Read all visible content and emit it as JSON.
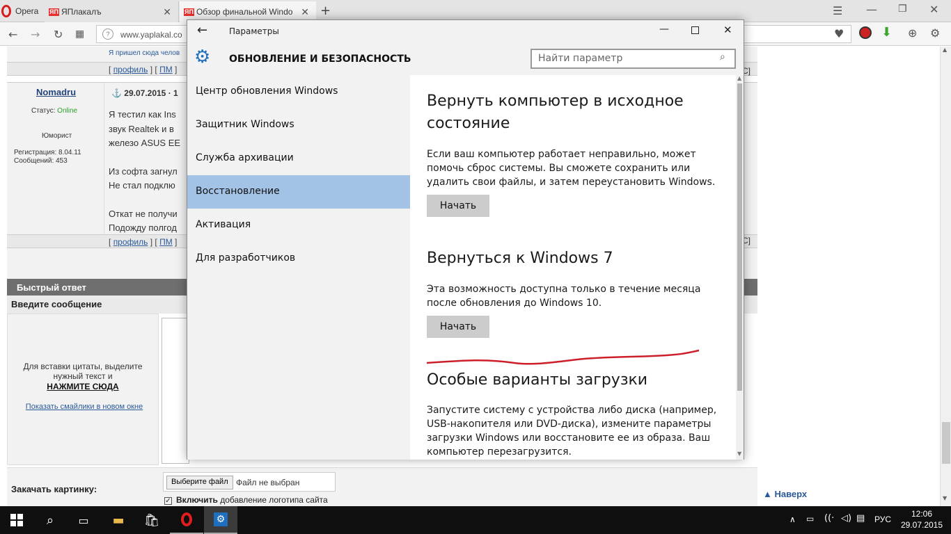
{
  "browser": {
    "brand": "Opera",
    "tabs": [
      {
        "label": "ЯПлакалъ",
        "fav": "ЯП"
      },
      {
        "label": "Обзор финальной Windo",
        "fav": "ЯП"
      }
    ],
    "address": "www.yaplakal.co",
    "new_tab": "+"
  },
  "forum": {
    "prev_post_text": "Я пришел сюда челов",
    "post_links": [
      "[",
      "профиль",
      "] [",
      "ПМ",
      "]"
    ],
    "author": "Nomadru",
    "post_date": "29.07.2015 · 1",
    "status_label": "Статус:",
    "status_value": "Online",
    "rank": "Юморист",
    "reg": "Регистрация: 8.04.11",
    "msgs": "Сообщений: 453",
    "post_lines": [
      "Я тестил как Ins",
      "звук Realtek и в",
      "железо ASUS EE",
      "",
      "Из софта загнул",
      "Не стал подклю",
      "",
      "Откат не получи",
      "Подожду полгод"
    ],
    "quick_reply": "Быстрый ответ",
    "enter_message": "Введите сообщение",
    "quote_hint": "Для вставки цитаты, выделите нужный текст и",
    "click_here": "НАЖМИТЕ СЮДА",
    "smiles_link": "Показать смайлики в новом окне",
    "upload_label": "Закачать картинку:",
    "choose_file": "Выберите файл",
    "no_file": "Файл не выбран",
    "logo_bold": "Включить",
    "logo_rest": "добавление логотипа сайта",
    "top_link": "Наверх"
  },
  "settings": {
    "title": "Параметры",
    "section": "ОБНОВЛЕНИЕ И БЕЗОПАСНОСТЬ",
    "search_placeholder": "Найти параметр",
    "nav": [
      {
        "label": "Центр обновления Windows"
      },
      {
        "label": "Защитник Windows"
      },
      {
        "label": "Служба архивации"
      },
      {
        "label": "Восстановление"
      },
      {
        "label": "Активация"
      },
      {
        "label": "Для разработчиков"
      }
    ],
    "selected_nav": "Восстановление",
    "reset": {
      "heading": "Вернуть компьютер в исходное состояние",
      "text": "Если ваш компьютер работает неправильно, может помочь сброс системы. Вы сможете сохранить или удалить свои файлы, и затем переустановить Windows.",
      "button": "Начать"
    },
    "rollback": {
      "heading": "Вернуться к Windows 7",
      "text": "Эта возможность доступна только в течение месяца после обновления до Windows 10.",
      "button": "Начать"
    },
    "advanced": {
      "heading": "Особые варианты загрузки",
      "text": "Запустите систему с устройства либо диска (например, USB-накопителя или DVD-диска), измените параметры загрузки Windows или восстановите ее из образа. Ваш компьютер перезагрузится."
    }
  },
  "taskbar": {
    "lang": "РУС",
    "time": "12:06",
    "date": "29.07.2015"
  },
  "colors": {
    "selected_nav": "#a3c3e6",
    "settings_icon": "#1f6fbf",
    "online": "#2aa02a",
    "annotation": "#cc1f2a"
  }
}
